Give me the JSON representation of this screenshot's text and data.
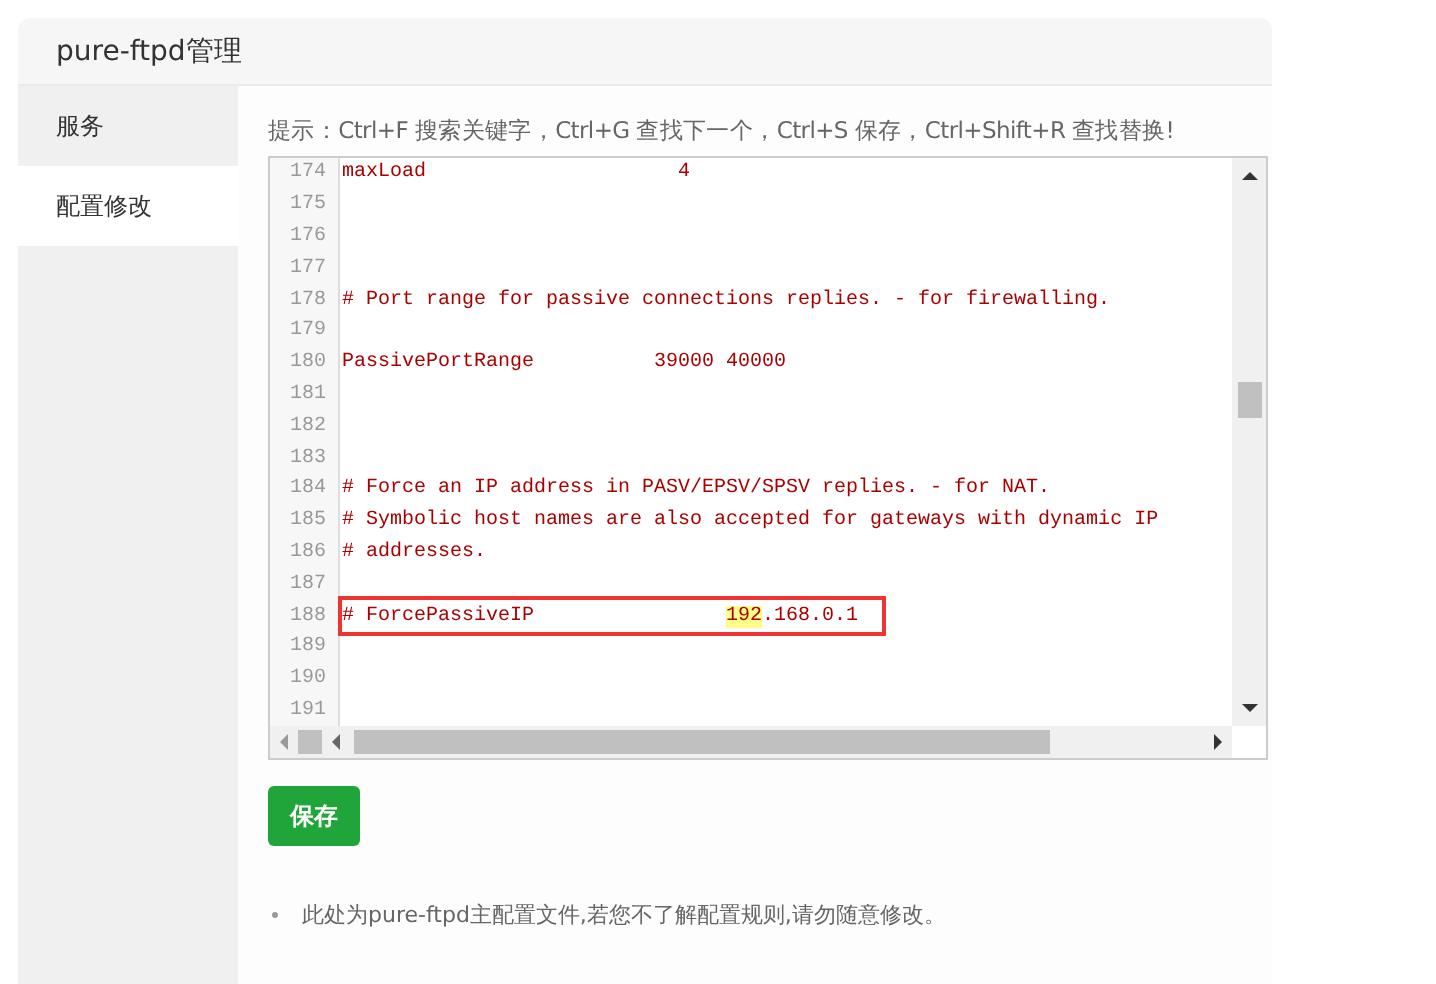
{
  "panel": {
    "title": "pure-ftpd管理"
  },
  "sidebar": {
    "items": [
      {
        "label": "服务",
        "selected": false
      },
      {
        "label": "配置修改",
        "selected": true
      }
    ]
  },
  "hint": "提示：Ctrl+F 搜索关键字，Ctrl+G 查找下一个，Ctrl+S 保存，Ctrl+Shift+R 查找替换!",
  "editor": {
    "lines": [
      {
        "number": "174",
        "boxed": false,
        "segments": [
          {
            "text": "maxLoad                     4",
            "highlight": false
          }
        ]
      },
      {
        "number": "175",
        "boxed": false
      },
      {
        "number": "176",
        "boxed": false
      },
      {
        "number": "177",
        "boxed": false
      },
      {
        "number": "178",
        "boxed": false,
        "segments": [
          {
            "text": "# Port range for passive connections replies. - for firewalling.",
            "highlight": false
          }
        ]
      },
      {
        "number": "179",
        "boxed": false
      },
      {
        "number": "180",
        "boxed": false,
        "segments": [
          {
            "text": "PassivePortRange          39000 40000",
            "highlight": false
          }
        ]
      },
      {
        "number": "181",
        "boxed": false
      },
      {
        "number": "182",
        "boxed": false
      },
      {
        "number": "183",
        "boxed": false
      },
      {
        "number": "184",
        "boxed": false,
        "segments": [
          {
            "text": "# Force an IP address in PASV/EPSV/SPSV replies. - for NAT.",
            "highlight": false
          }
        ]
      },
      {
        "number": "185",
        "boxed": false,
        "segments": [
          {
            "text": "# Symbolic host names are also accepted for gateways with dynamic IP",
            "highlight": false
          }
        ]
      },
      {
        "number": "186",
        "boxed": false,
        "segments": [
          {
            "text": "# addresses.",
            "highlight": false
          }
        ]
      },
      {
        "number": "187",
        "boxed": false
      },
      {
        "number": "188",
        "boxed": true,
        "segments": [
          {
            "text": "# ForcePassiveIP                ",
            "highlight": false
          },
          {
            "text": "192",
            "highlight": true
          },
          {
            "text": ".168.0.1",
            "highlight": false
          }
        ]
      },
      {
        "number": "189",
        "boxed": false
      },
      {
        "number": "190",
        "boxed": false
      },
      {
        "number": "191",
        "boxed": false
      }
    ]
  },
  "save_button": "保存",
  "notes": [
    "此处为pure-ftpd主配置文件,若您不了解配置规则,请勿随意修改。"
  ]
}
